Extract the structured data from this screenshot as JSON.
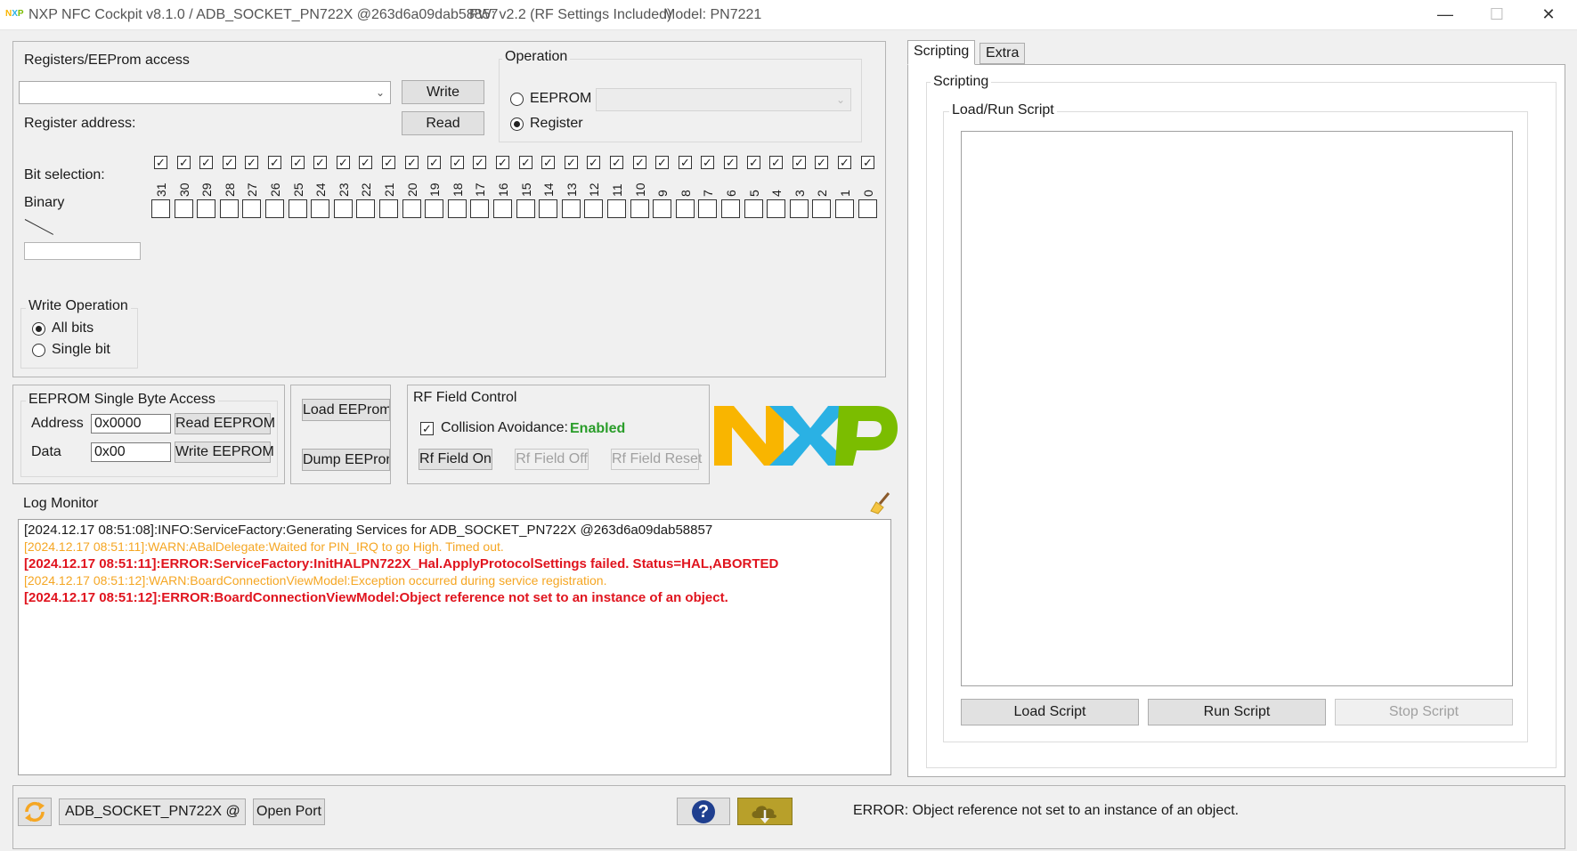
{
  "window": {
    "title": "NXP NFC Cockpit v8.1.0 / ADB_SOCKET_PN722X @263d6a09dab58857",
    "fw": "FW: v2.2 (RF Settings Included)",
    "model": "Model: PN7221",
    "minimize": "—",
    "maximize": "☐",
    "close": "✕"
  },
  "registers": {
    "title": "Registers/EEProm access",
    "write_label": "Write",
    "read_label": "Read",
    "address_label": "Register address:",
    "bit_selection_label": "Bit selection:",
    "binary_label": "Binary",
    "bits": [
      "31",
      "30",
      "29",
      "28",
      "27",
      "26",
      "25",
      "24",
      "23",
      "22",
      "21",
      "20",
      "19",
      "18",
      "17",
      "16",
      "15",
      "14",
      "13",
      "12",
      "11",
      "10",
      "9",
      "8",
      "7",
      "6",
      "5",
      "4",
      "3",
      "2",
      "1",
      "0"
    ],
    "write_operation": {
      "title": "Write Operation",
      "all_bits": "All bits",
      "single_bit": "Single bit",
      "selected": "All bits"
    }
  },
  "operation": {
    "title": "Operation",
    "eeprom": "EEPROM",
    "register": "Register",
    "selected": "Register"
  },
  "eeprom_single": {
    "title": "EEPROM Single Byte Access",
    "address_label": "Address",
    "address_value": "0x0000",
    "data_label": "Data",
    "data_value": "0x00",
    "read_btn": "Read EEPROM",
    "write_btn": "Write EEPROM"
  },
  "eeprom_file": {
    "load_btn": "Load EEProm",
    "dump_btn": "Dump EEProm"
  },
  "rf_field": {
    "title": "RF Field Control",
    "collision_label": "Collision Avoidance:",
    "collision_status": "Enabled",
    "on_btn": "Rf Field On",
    "off_btn": "Rf Field Off",
    "reset_btn": "Rf Field Reset"
  },
  "logo": {
    "text": "NXP"
  },
  "log": {
    "title": "Log Monitor",
    "clear_icon": "broom-icon",
    "lines": [
      {
        "text": "[2024.12.17 08:51:08]:INFO:ServiceFactory:Generating Services for ADB_SOCKET_PN722X @263d6a09dab58857",
        "level": "info"
      },
      {
        "text": "[2024.12.17 08:51:11]:WARN:ABalDelegate:Waited for PIN_IRQ to go High. Timed out.",
        "level": "warn"
      },
      {
        "text": "[2024.12.17 08:51:11]:ERROR:ServiceFactory:InitHALPN722X_Hal.ApplyProtocolSettings failed. Status=HAL,ABORTED",
        "level": "error"
      },
      {
        "text": "[2024.12.17 08:51:12]:WARN:BoardConnectionViewModel:Exception occurred during service registration.",
        "level": "warn"
      },
      {
        "text": "[2024.12.17 08:51:12]:ERROR:BoardConnectionViewModel:Object reference not set to an instance of an object.",
        "level": "error"
      }
    ]
  },
  "tabs": {
    "scripting": "Scripting",
    "extra": "Extra",
    "active": "Scripting"
  },
  "scripting": {
    "group_title": "Scripting",
    "load_run_title": "Load/Run Script",
    "load_btn": "Load Script",
    "run_btn": "Run Script",
    "stop_btn": "Stop Script"
  },
  "statusbar": {
    "refresh_icon": "refresh-icon",
    "port_value": "ADB_SOCKET_PN722X @",
    "open_port": "Open Port",
    "help_icon": "?",
    "cloud_icon": "cloud-download-icon",
    "status_message": "ERROR: Object reference not set to an instance of an object."
  },
  "colors": {
    "warn": "#f5a623",
    "error": "#e0141e",
    "enabled": "#2a9d2a",
    "nxp_orange": "#f9b500",
    "nxp_blue": "#2ab1e4",
    "nxp_green": "#7bbd00"
  }
}
